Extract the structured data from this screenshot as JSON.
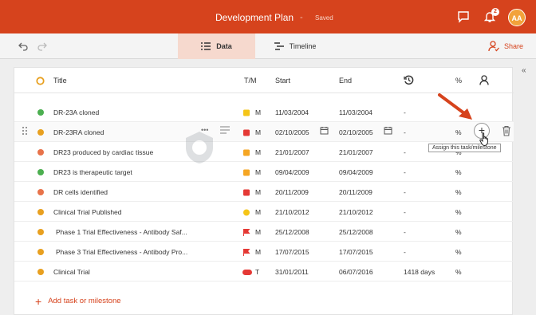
{
  "header": {
    "title": "Development Plan",
    "separator": "-",
    "status": "Saved",
    "notification_count": "2",
    "avatar_initials": "AA"
  },
  "toolbar": {
    "tabs": [
      "Data",
      "Timeline"
    ],
    "active_tab": "Data",
    "share_label": "Share"
  },
  "columns": {
    "title": "Title",
    "tm": "T/M",
    "start": "Start",
    "end": "End",
    "percent": "%"
  },
  "rows": [
    {
      "dot_color": "#4caf50",
      "title": "DR-23A cloned",
      "icon": "square",
      "icon_color": "#f5c518",
      "tm": "M",
      "start": "11/03/2004",
      "end": "11/03/2004",
      "duration": "-",
      "percent": ""
    },
    {
      "dot_color": "#e8a020",
      "title": "DR-23RA cloned",
      "icon": "square",
      "icon_color": "#e53935",
      "tm": "M",
      "start": "02/10/2005",
      "end": "02/10/2005",
      "duration": "-",
      "percent": "%"
    },
    {
      "dot_color": "#e8734a",
      "title": "DR23 produced by cardiac tissue",
      "icon": "square",
      "icon_color": "#f5a623",
      "tm": "M",
      "start": "21/01/2007",
      "end": "21/01/2007",
      "duration": "-",
      "percent": "%"
    },
    {
      "dot_color": "#4caf50",
      "title": "DR23 is therapeutic target",
      "icon": "square",
      "icon_color": "#f5a623",
      "tm": "M",
      "start": "09/04/2009",
      "end": "09/04/2009",
      "duration": "-",
      "percent": "%"
    },
    {
      "dot_color": "#e8734a",
      "title": "DR cells identified",
      "icon": "square",
      "icon_color": "#e53935",
      "tm": "M",
      "start": "20/11/2009",
      "end": "20/11/2009",
      "duration": "-",
      "percent": "%"
    },
    {
      "dot_color": "#e8a020",
      "title": "Clinical Trial Published",
      "icon": "circle",
      "icon_color": "#f5c518",
      "tm": "M",
      "start": "21/10/2012",
      "end": "21/10/2012",
      "duration": "-",
      "percent": "%"
    },
    {
      "dot_color": "#e8a020",
      "title": "Phase 1 Trial Effectiveness - Antibody Saf...",
      "icon": "flag",
      "icon_color": "#e53935",
      "tm": "M",
      "start": "25/12/2008",
      "end": "25/12/2008",
      "duration": "-",
      "percent": "%"
    },
    {
      "dot_color": "#e8a020",
      "title": "Phase 3 Trial Effectiveness - Antibody Pro...",
      "icon": "flag",
      "icon_color": "#e53935",
      "tm": "M",
      "start": "17/07/2015",
      "end": "17/07/2015",
      "duration": "-",
      "percent": "%"
    },
    {
      "dot_color": "#e8a020",
      "title": "Clinical Trial",
      "icon": "pill",
      "icon_color": "#e53935",
      "tm": "T",
      "start": "31/01/2011",
      "end": "06/07/2016",
      "duration": "1418 days",
      "percent": "%"
    }
  ],
  "hover_row_index": 1,
  "tooltip": "Assign this task/milestone",
  "add_label": "Add task or milestone",
  "colors": {
    "brand": "#d6431d",
    "active_tab_bg": "#f6d9ce"
  }
}
